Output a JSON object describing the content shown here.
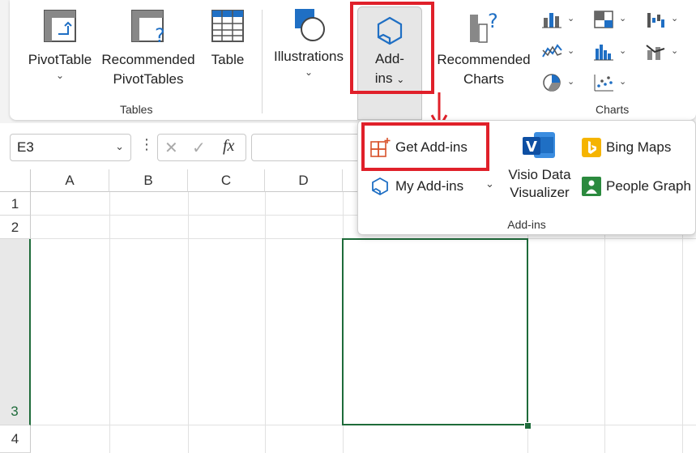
{
  "ribbon": {
    "tables_group": {
      "label": "Tables",
      "pivot_table": {
        "line1": "PivotTable",
        "chevron": "⌄"
      },
      "recommended_pivot": {
        "line1": "Recommended",
        "line2": "PivotTables"
      },
      "table": {
        "label": "Table"
      }
    },
    "illustrations": {
      "label": "Illustrations",
      "chevron": "⌄"
    },
    "addins_button": {
      "line1": "Add-",
      "line2": "ins",
      "chevron": "⌄"
    },
    "charts_group": {
      "label": "Charts",
      "recommended_charts": {
        "line1": "Recommended",
        "line2": "Charts"
      }
    }
  },
  "formula_bar": {
    "name_box_value": "E3",
    "name_box_chevron": "⌄",
    "more": "⋮",
    "cancel": "✕",
    "enter": "✓",
    "fx": "fx"
  },
  "grid": {
    "columns": [
      "A",
      "B",
      "C",
      "D"
    ],
    "rows": [
      "1",
      "2",
      "3",
      "4"
    ],
    "selected_cell": "E3"
  },
  "addins_menu": {
    "get_addins": "Get Add-ins",
    "my_addins": "My Add-ins",
    "my_addins_chevron": "⌄",
    "visio_line1": "Visio Data",
    "visio_line2": "Visualizer",
    "bing_maps": "Bing Maps",
    "people_graph": "People Graph",
    "group_label": "Add-ins"
  },
  "colors": {
    "highlight_red": "#e0202a",
    "selection_green": "#1e6b3a",
    "addin_blue": "#1f6fc4"
  }
}
